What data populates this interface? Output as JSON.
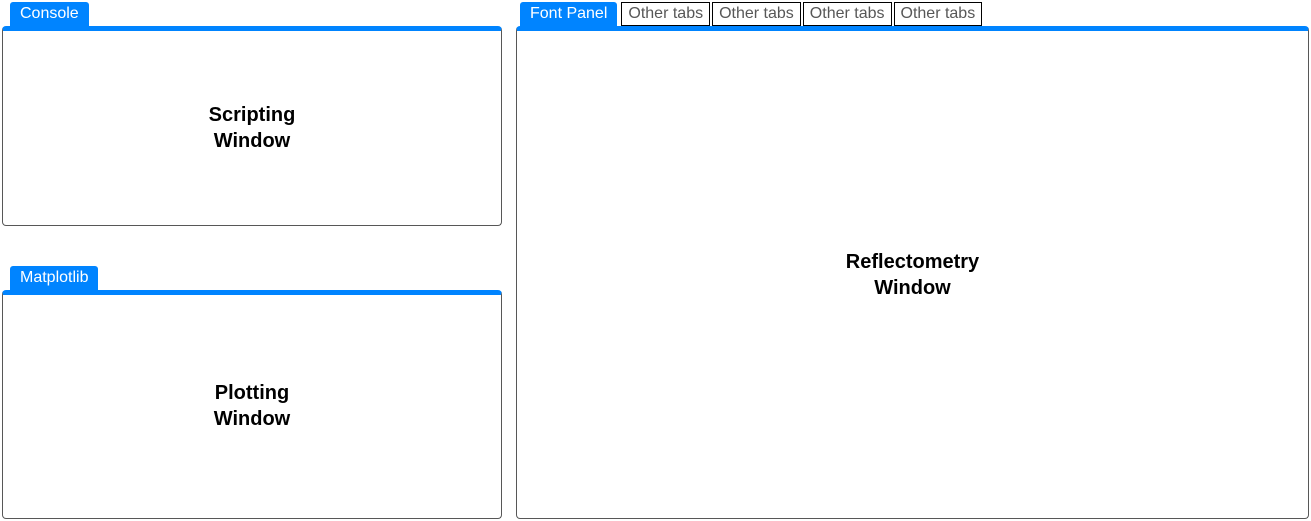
{
  "left": {
    "scripting": {
      "tab_label": "Console",
      "title": "Scripting\nWindow"
    },
    "plotting": {
      "tab_label": "Matplotlib",
      "title": "Plotting\nWindow"
    }
  },
  "right": {
    "reflectometry": {
      "tab_label": "Font Panel",
      "other_tabs": [
        "Other tabs",
        "Other tabs",
        "Other tabs",
        "Other tabs"
      ],
      "title": "Reflectometry\nWindow"
    }
  }
}
